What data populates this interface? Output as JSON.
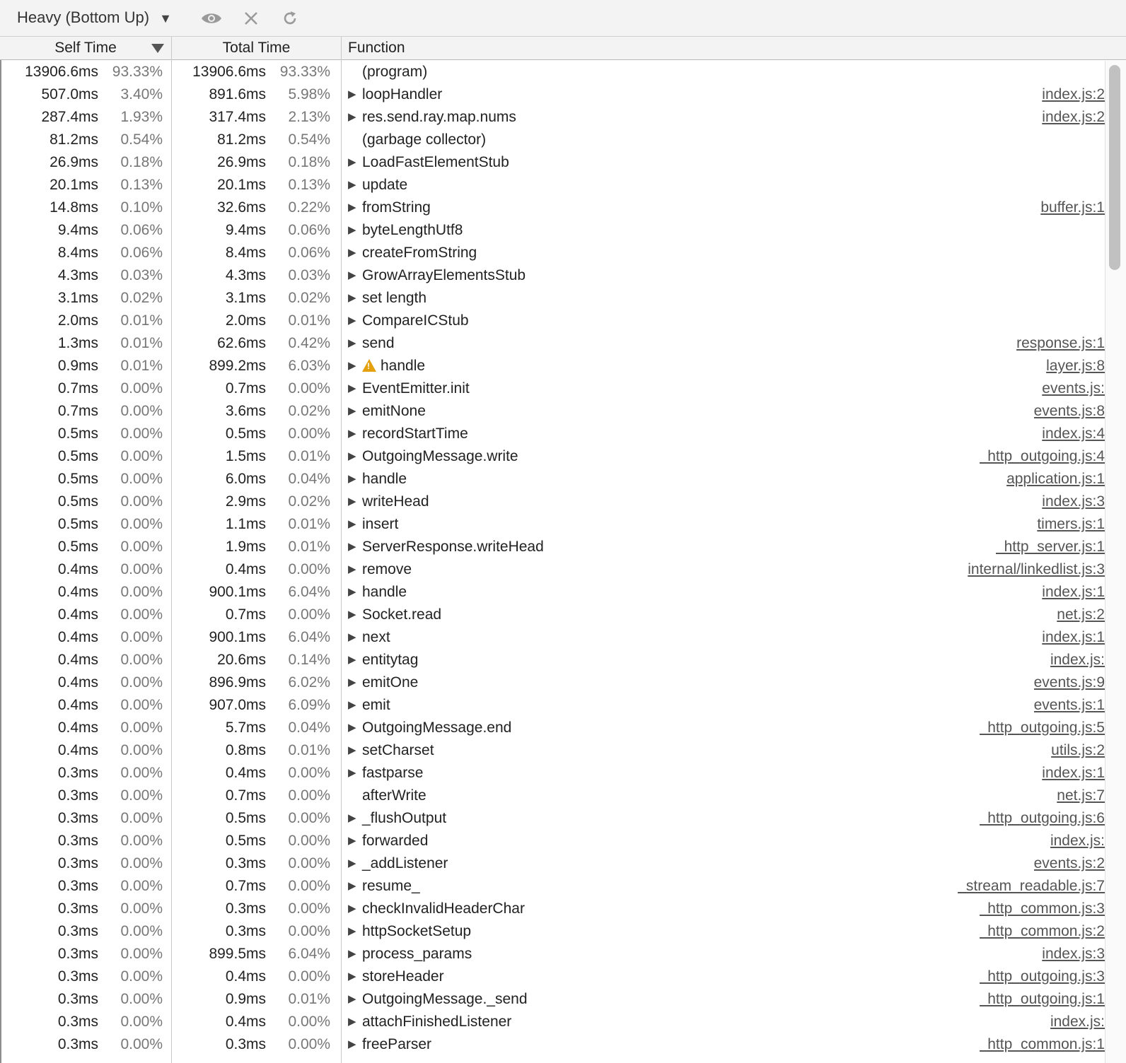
{
  "toolbar": {
    "view_label": "Heavy (Bottom Up)",
    "caret_icon": "triangle-down-icon",
    "focus_icon": "eye-icon",
    "exclude_icon": "close-icon",
    "restore_icon": "refresh-icon"
  },
  "columns": {
    "self_time": "Self Time",
    "total_time": "Total Time",
    "function": "Function",
    "sort_column": "Self Time",
    "sort_direction": "descending"
  },
  "rows": [
    {
      "self_time": "13906.6ms",
      "self_pct": "93.33%",
      "total_time": "13906.6ms",
      "total_pct": "93.33%",
      "function": "(program)",
      "expandable": false,
      "warning": false,
      "url": ""
    },
    {
      "self_time": "507.0ms",
      "self_pct": "3.40%",
      "total_time": "891.6ms",
      "total_pct": "5.98%",
      "function": "loopHandler",
      "expandable": true,
      "warning": false,
      "url": "index.js:2"
    },
    {
      "self_time": "287.4ms",
      "self_pct": "1.93%",
      "total_time": "317.4ms",
      "total_pct": "2.13%",
      "function": "res.send.ray.map.nums",
      "expandable": true,
      "warning": false,
      "url": "index.js:2"
    },
    {
      "self_time": "81.2ms",
      "self_pct": "0.54%",
      "total_time": "81.2ms",
      "total_pct": "0.54%",
      "function": "(garbage collector)",
      "expandable": false,
      "warning": false,
      "url": ""
    },
    {
      "self_time": "26.9ms",
      "self_pct": "0.18%",
      "total_time": "26.9ms",
      "total_pct": "0.18%",
      "function": "LoadFastElementStub",
      "expandable": true,
      "warning": false,
      "url": ""
    },
    {
      "self_time": "20.1ms",
      "self_pct": "0.13%",
      "total_time": "20.1ms",
      "total_pct": "0.13%",
      "function": "update",
      "expandable": true,
      "warning": false,
      "url": ""
    },
    {
      "self_time": "14.8ms",
      "self_pct": "0.10%",
      "total_time": "32.6ms",
      "total_pct": "0.22%",
      "function": "fromString",
      "expandable": true,
      "warning": false,
      "url": "buffer.js:1"
    },
    {
      "self_time": "9.4ms",
      "self_pct": "0.06%",
      "total_time": "9.4ms",
      "total_pct": "0.06%",
      "function": "byteLengthUtf8",
      "expandable": true,
      "warning": false,
      "url": ""
    },
    {
      "self_time": "8.4ms",
      "self_pct": "0.06%",
      "total_time": "8.4ms",
      "total_pct": "0.06%",
      "function": "createFromString",
      "expandable": true,
      "warning": false,
      "url": ""
    },
    {
      "self_time": "4.3ms",
      "self_pct": "0.03%",
      "total_time": "4.3ms",
      "total_pct": "0.03%",
      "function": "GrowArrayElementsStub",
      "expandable": true,
      "warning": false,
      "url": ""
    },
    {
      "self_time": "3.1ms",
      "self_pct": "0.02%",
      "total_time": "3.1ms",
      "total_pct": "0.02%",
      "function": "set length",
      "expandable": true,
      "warning": false,
      "url": ""
    },
    {
      "self_time": "2.0ms",
      "self_pct": "0.01%",
      "total_time": "2.0ms",
      "total_pct": "0.01%",
      "function": "CompareICStub",
      "expandable": true,
      "warning": false,
      "url": ""
    },
    {
      "self_time": "1.3ms",
      "self_pct": "0.01%",
      "total_time": "62.6ms",
      "total_pct": "0.42%",
      "function": "send",
      "expandable": true,
      "warning": false,
      "url": "response.js:1"
    },
    {
      "self_time": "0.9ms",
      "self_pct": "0.01%",
      "total_time": "899.2ms",
      "total_pct": "6.03%",
      "function": "handle",
      "expandable": true,
      "warning": true,
      "url": "layer.js:8"
    },
    {
      "self_time": "0.7ms",
      "self_pct": "0.00%",
      "total_time": "0.7ms",
      "total_pct": "0.00%",
      "function": "EventEmitter.init",
      "expandable": true,
      "warning": false,
      "url": "events.js:"
    },
    {
      "self_time": "0.7ms",
      "self_pct": "0.00%",
      "total_time": "3.6ms",
      "total_pct": "0.02%",
      "function": "emitNone",
      "expandable": true,
      "warning": false,
      "url": "events.js:8"
    },
    {
      "self_time": "0.5ms",
      "self_pct": "0.00%",
      "total_time": "0.5ms",
      "total_pct": "0.00%",
      "function": "recordStartTime",
      "expandable": true,
      "warning": false,
      "url": "index.js:4"
    },
    {
      "self_time": "0.5ms",
      "self_pct": "0.00%",
      "total_time": "1.5ms",
      "total_pct": "0.01%",
      "function": "OutgoingMessage.write",
      "expandable": true,
      "warning": false,
      "url": "_http_outgoing.js:4"
    },
    {
      "self_time": "0.5ms",
      "self_pct": "0.00%",
      "total_time": "6.0ms",
      "total_pct": "0.04%",
      "function": "handle",
      "expandable": true,
      "warning": false,
      "url": "application.js:1"
    },
    {
      "self_time": "0.5ms",
      "self_pct": "0.00%",
      "total_time": "2.9ms",
      "total_pct": "0.02%",
      "function": "writeHead",
      "expandable": true,
      "warning": false,
      "url": "index.js:3"
    },
    {
      "self_time": "0.5ms",
      "self_pct": "0.00%",
      "total_time": "1.1ms",
      "total_pct": "0.01%",
      "function": "insert",
      "expandable": true,
      "warning": false,
      "url": "timers.js:1"
    },
    {
      "self_time": "0.5ms",
      "self_pct": "0.00%",
      "total_time": "1.9ms",
      "total_pct": "0.01%",
      "function": "ServerResponse.writeHead",
      "expandable": true,
      "warning": false,
      "url": "_http_server.js:1"
    },
    {
      "self_time": "0.4ms",
      "self_pct": "0.00%",
      "total_time": "0.4ms",
      "total_pct": "0.00%",
      "function": "remove",
      "expandable": true,
      "warning": false,
      "url": "internal/linkedlist.js:3"
    },
    {
      "self_time": "0.4ms",
      "self_pct": "0.00%",
      "total_time": "900.1ms",
      "total_pct": "6.04%",
      "function": "handle",
      "expandable": true,
      "warning": false,
      "url": "index.js:1"
    },
    {
      "self_time": "0.4ms",
      "self_pct": "0.00%",
      "total_time": "0.7ms",
      "total_pct": "0.00%",
      "function": "Socket.read",
      "expandable": true,
      "warning": false,
      "url": "net.js:2"
    },
    {
      "self_time": "0.4ms",
      "self_pct": "0.00%",
      "total_time": "900.1ms",
      "total_pct": "6.04%",
      "function": "next",
      "expandable": true,
      "warning": false,
      "url": "index.js:1"
    },
    {
      "self_time": "0.4ms",
      "self_pct": "0.00%",
      "total_time": "20.6ms",
      "total_pct": "0.14%",
      "function": "entitytag",
      "expandable": true,
      "warning": false,
      "url": "index.js:"
    },
    {
      "self_time": "0.4ms",
      "self_pct": "0.00%",
      "total_time": "896.9ms",
      "total_pct": "6.02%",
      "function": "emitOne",
      "expandable": true,
      "warning": false,
      "url": "events.js:9"
    },
    {
      "self_time": "0.4ms",
      "self_pct": "0.00%",
      "total_time": "907.0ms",
      "total_pct": "6.09%",
      "function": "emit",
      "expandable": true,
      "warning": false,
      "url": "events.js:1"
    },
    {
      "self_time": "0.4ms",
      "self_pct": "0.00%",
      "total_time": "5.7ms",
      "total_pct": "0.04%",
      "function": "OutgoingMessage.end",
      "expandable": true,
      "warning": false,
      "url": "_http_outgoing.js:5"
    },
    {
      "self_time": "0.4ms",
      "self_pct": "0.00%",
      "total_time": "0.8ms",
      "total_pct": "0.01%",
      "function": "setCharset",
      "expandable": true,
      "warning": false,
      "url": "utils.js:2"
    },
    {
      "self_time": "0.3ms",
      "self_pct": "0.00%",
      "total_time": "0.4ms",
      "total_pct": "0.00%",
      "function": "fastparse",
      "expandable": true,
      "warning": false,
      "url": "index.js:1"
    },
    {
      "self_time": "0.3ms",
      "self_pct": "0.00%",
      "total_time": "0.7ms",
      "total_pct": "0.00%",
      "function": "afterWrite",
      "expandable": false,
      "warning": false,
      "url": "net.js:7"
    },
    {
      "self_time": "0.3ms",
      "self_pct": "0.00%",
      "total_time": "0.5ms",
      "total_pct": "0.00%",
      "function": "_flushOutput",
      "expandable": true,
      "warning": false,
      "url": "_http_outgoing.js:6"
    },
    {
      "self_time": "0.3ms",
      "self_pct": "0.00%",
      "total_time": "0.5ms",
      "total_pct": "0.00%",
      "function": "forwarded",
      "expandable": true,
      "warning": false,
      "url": "index.js:"
    },
    {
      "self_time": "0.3ms",
      "self_pct": "0.00%",
      "total_time": "0.3ms",
      "total_pct": "0.00%",
      "function": "_addListener",
      "expandable": true,
      "warning": false,
      "url": "events.js:2"
    },
    {
      "self_time": "0.3ms",
      "self_pct": "0.00%",
      "total_time": "0.7ms",
      "total_pct": "0.00%",
      "function": "resume_",
      "expandable": true,
      "warning": false,
      "url": "_stream_readable.js:7"
    },
    {
      "self_time": "0.3ms",
      "self_pct": "0.00%",
      "total_time": "0.3ms",
      "total_pct": "0.00%",
      "function": "checkInvalidHeaderChar",
      "expandable": true,
      "warning": false,
      "url": "_http_common.js:3"
    },
    {
      "self_time": "0.3ms",
      "self_pct": "0.00%",
      "total_time": "0.3ms",
      "total_pct": "0.00%",
      "function": "httpSocketSetup",
      "expandable": true,
      "warning": false,
      "url": "_http_common.js:2"
    },
    {
      "self_time": "0.3ms",
      "self_pct": "0.00%",
      "total_time": "899.5ms",
      "total_pct": "6.04%",
      "function": "process_params",
      "expandable": true,
      "warning": false,
      "url": "index.js:3"
    },
    {
      "self_time": "0.3ms",
      "self_pct": "0.00%",
      "total_time": "0.4ms",
      "total_pct": "0.00%",
      "function": "storeHeader",
      "expandable": true,
      "warning": false,
      "url": "_http_outgoing.js:3"
    },
    {
      "self_time": "0.3ms",
      "self_pct": "0.00%",
      "total_time": "0.9ms",
      "total_pct": "0.01%",
      "function": "OutgoingMessage._send",
      "expandable": true,
      "warning": false,
      "url": "_http_outgoing.js:1"
    },
    {
      "self_time": "0.3ms",
      "self_pct": "0.00%",
      "total_time": "0.4ms",
      "total_pct": "0.00%",
      "function": "attachFinishedListener",
      "expandable": true,
      "warning": false,
      "url": "index.js:"
    },
    {
      "self_time": "0.3ms",
      "self_pct": "0.00%",
      "total_time": "0.3ms",
      "total_pct": "0.00%",
      "function": "freeParser",
      "expandable": true,
      "warning": false,
      "url": "_http_common.js:1"
    }
  ]
}
